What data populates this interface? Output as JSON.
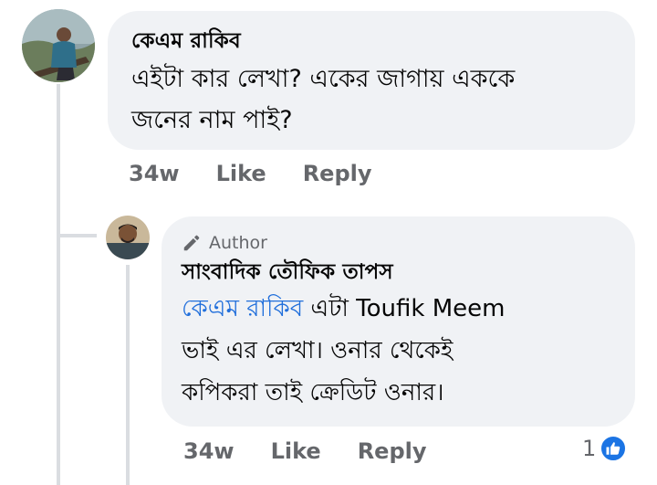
{
  "comments": [
    {
      "author": "কেএম রাকিব",
      "text_lines": [
        "এইটা কার লেখা? একের জাগায় এককে",
        "জনের নাম পাই?"
      ],
      "time": "34w",
      "like_label": "Like",
      "reply_label": "Reply"
    }
  ],
  "reply": {
    "badge_label": "Author",
    "author": "সাংবাদিক তৌফিক তাপস",
    "mention": "কেএম রাকিব",
    "text_line1_rest": " এটা Toufik Meem",
    "text_lines": [
      "ভাই এর লেখা। ওনার থেকেই",
      "কপিকরা তাই ক্রেডিট ওনার।"
    ],
    "time": "34w",
    "like_label": "Like",
    "reply_label": "Reply",
    "reaction_count": "1",
    "reaction_icon": "like-thumb-icon"
  },
  "colors": {
    "bubble": "#f0f2f5",
    "mention": "#216fdb",
    "secondary_text": "#65676b",
    "like_blue": "#1b74e4"
  }
}
